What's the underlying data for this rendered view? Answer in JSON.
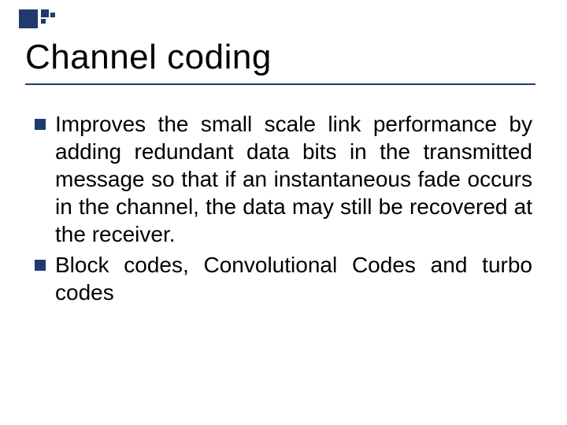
{
  "slide": {
    "title": "Channel coding",
    "bullets": [
      "Improves the small scale link performance by adding redundant data bits in the transmitted message so that if an instantaneous fade occurs in the channel, the data may still be recovered at the receiver.",
      "Block codes, Convolutional Codes and turbo codes"
    ]
  }
}
